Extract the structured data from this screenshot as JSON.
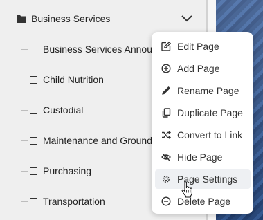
{
  "tree": {
    "folder": {
      "label": "Business Services",
      "icon": "folder-icon"
    },
    "pages": [
      {
        "label": "Business Services Announ",
        "icon": "page-icon"
      },
      {
        "label": "Child Nutrition",
        "icon": "page-icon"
      },
      {
        "label": "Custodial",
        "icon": "page-icon"
      },
      {
        "label": "Maintenance and Ground",
        "icon": "page-icon"
      },
      {
        "label": "Purchasing",
        "icon": "page-icon"
      },
      {
        "label": "Transportation",
        "icon": "page-icon"
      }
    ]
  },
  "menu": {
    "items": [
      {
        "label": "Edit Page",
        "icon": "edit-icon"
      },
      {
        "label": "Add Page",
        "icon": "add-circle-icon"
      },
      {
        "label": "Rename Page",
        "icon": "pencil-icon"
      },
      {
        "label": "Duplicate Page",
        "icon": "duplicate-icon"
      },
      {
        "label": "Convert to Link",
        "icon": "shuffle-icon"
      },
      {
        "label": "Hide Page",
        "icon": "eye-off-icon"
      },
      {
        "label": "Page Settings",
        "icon": "gear-icon",
        "hovered": true
      },
      {
        "label": "Delete Page",
        "icon": "minus-circle-icon"
      }
    ]
  },
  "colors": {
    "hover_background": "#eef0f3",
    "menu_text": "#333333"
  }
}
